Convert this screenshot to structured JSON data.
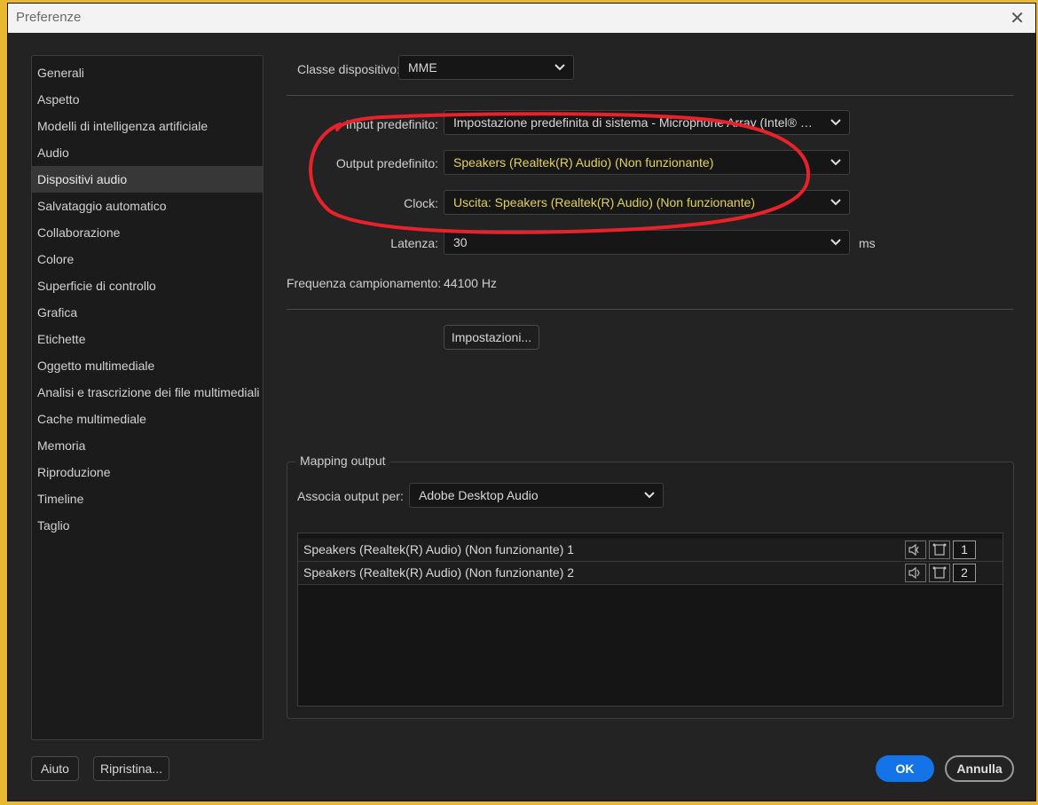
{
  "window": {
    "title": "Preferenze"
  },
  "sidebar": {
    "items": [
      {
        "label": "Generali"
      },
      {
        "label": "Aspetto"
      },
      {
        "label": "Modelli di intelligenza artificiale"
      },
      {
        "label": "Audio"
      },
      {
        "label": "Dispositivi audio",
        "selected": true
      },
      {
        "label": "Salvataggio automatico"
      },
      {
        "label": "Collaborazione"
      },
      {
        "label": "Colore"
      },
      {
        "label": "Superficie di controllo"
      },
      {
        "label": "Grafica"
      },
      {
        "label": "Etichette"
      },
      {
        "label": "Oggetto multimediale"
      },
      {
        "label": "Analisi e trascrizione dei file multimediali"
      },
      {
        "label": "Cache multimediale"
      },
      {
        "label": "Memoria"
      },
      {
        "label": "Riproduzione"
      },
      {
        "label": "Timeline"
      },
      {
        "label": "Taglio"
      }
    ]
  },
  "device": {
    "class_label": "Classe dispositivo:",
    "class_value": "MME",
    "input_label": "Input predefinito:",
    "input_value": "Impostazione predefinita di sistema - Microphone Array (Intel® Smart Sound Technology)",
    "output_label": "Output predefinito:",
    "output_value": "Speakers (Realtek(R) Audio) (Non funzionante)",
    "clock_label": "Clock:",
    "clock_value": "Uscita: Speakers (Realtek(R) Audio) (Non funzionante)",
    "latency_label": "Latenza:",
    "latency_value": "30",
    "latency_unit": "ms",
    "samplerate_label": "Frequenza campionamento:",
    "samplerate_value": "44100 Hz",
    "settings_button": "Impostazioni..."
  },
  "mapping": {
    "group_title": "Mapping output",
    "associate_label": "Associa output per:",
    "associate_value": "Adobe Desktop Audio",
    "rows": [
      {
        "name": "Speakers (Realtek(R) Audio) (Non funzionante) 1",
        "channel": "1"
      },
      {
        "name": "Speakers (Realtek(R) Audio) (Non funzionante) 2",
        "channel": "2"
      }
    ]
  },
  "footer": {
    "help": "Aiuto",
    "reset": "Ripristina...",
    "ok": "OK",
    "cancel": "Annulla"
  },
  "colors": {
    "accent": "#1473e6",
    "warning_text": "#e3d25a",
    "annotation": "#e8222a"
  }
}
